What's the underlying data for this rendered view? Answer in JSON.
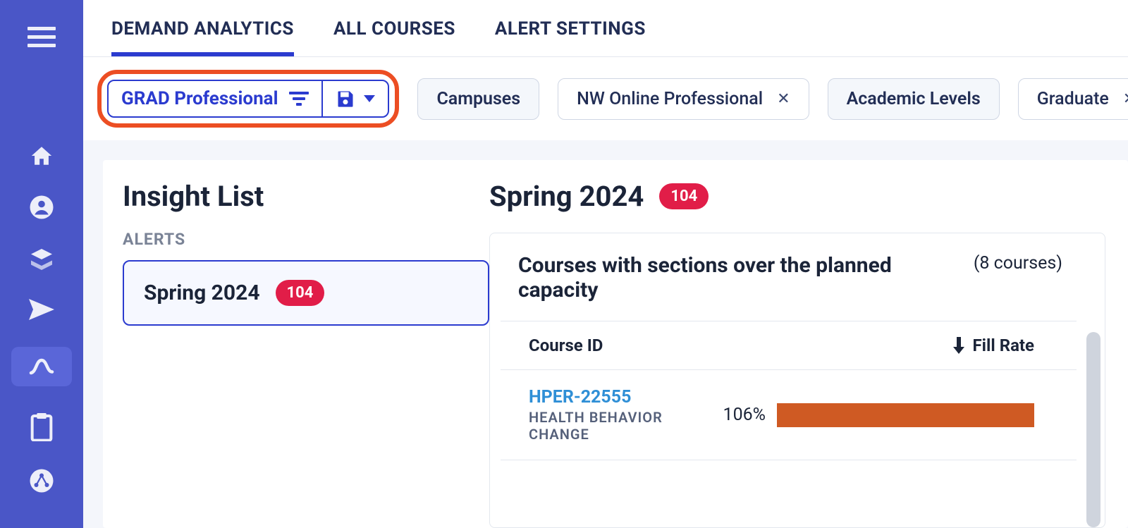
{
  "tabs": {
    "demand_analytics": "DEMAND ANALYTICS",
    "all_courses": "ALL COURSES",
    "alert_settings": "ALERT SETTINGS"
  },
  "saved_view": {
    "name": "GRAD Professional"
  },
  "filters": {
    "campuses_label": "Campuses",
    "campuses_value": "NW Online Professional",
    "levels_label": "Academic Levels",
    "levels_value": "Graduate"
  },
  "insight": {
    "title": "Insight List",
    "alerts_label": "ALERTS",
    "alert_item": {
      "term": "Spring 2024",
      "count": "104"
    }
  },
  "detail": {
    "term": "Spring 2024",
    "count": "104",
    "card_title": "Courses with sections over the planned capacity",
    "card_count": "(8 courses)",
    "col_course_id": "Course ID",
    "col_fill_rate": "Fill Rate",
    "rows": [
      {
        "id": "HPER-22555",
        "name": "HEALTH BEHAVIOR CHANGE",
        "pct": "106%"
      }
    ]
  }
}
